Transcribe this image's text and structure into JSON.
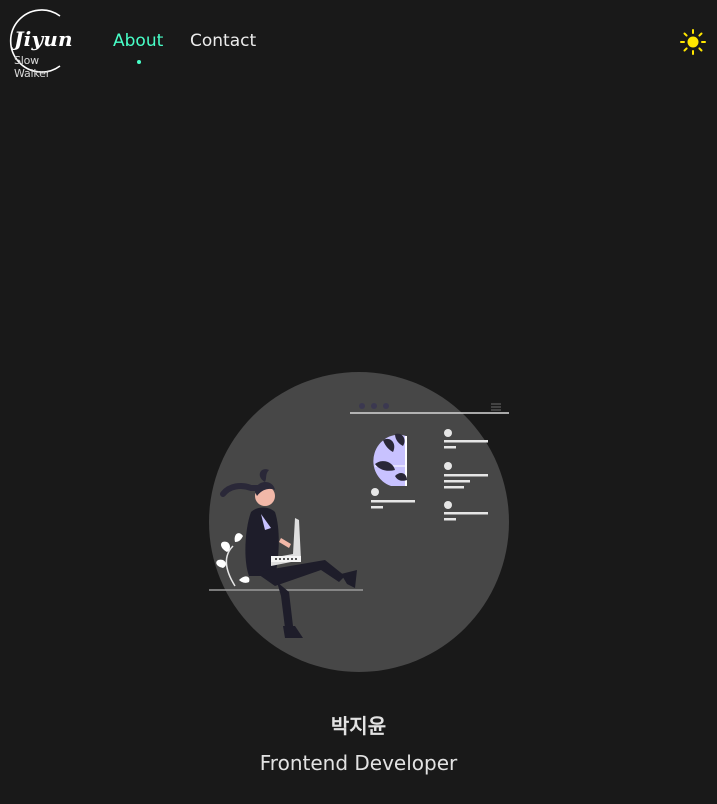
{
  "logo": {
    "title": "Jiyun",
    "subtitle": "Slow Walker"
  },
  "nav": {
    "items": [
      {
        "label": "About",
        "active": true
      },
      {
        "label": "Contact",
        "active": false
      }
    ]
  },
  "theme_toggle": {
    "icon": "sun-icon",
    "color": "#ffe600"
  },
  "colors": {
    "accent": "#48ffc8",
    "background": "#191919",
    "illustration_circle": "#474747",
    "illustration_accent": "#c8c2ff"
  },
  "profile": {
    "name": "박지윤",
    "role": "Frontend Developer"
  }
}
